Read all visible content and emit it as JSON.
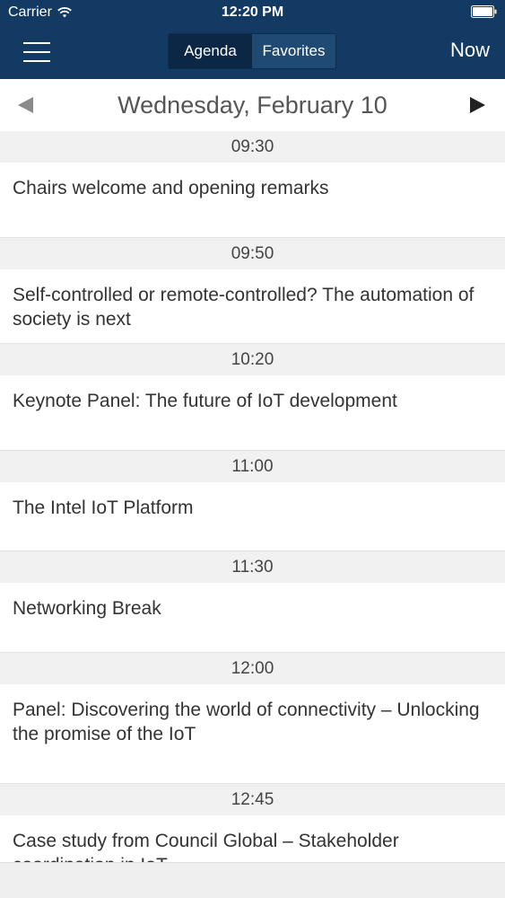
{
  "status_bar": {
    "carrier": "Carrier",
    "time": "12:20 PM"
  },
  "nav": {
    "segments": [
      "Agenda",
      "Favorites"
    ],
    "active_segment": "Agenda",
    "now_label": "Now"
  },
  "date_bar": {
    "date": "Wednesday, February 10"
  },
  "schedule": [
    {
      "time": "09:30",
      "title": "Chairs welcome and opening remarks"
    },
    {
      "time": "09:50",
      "title": "Self-controlled or remote-controlled? The automation of society is next"
    },
    {
      "time": "10:20",
      "title": "Keynote Panel: The future of IoT development"
    },
    {
      "time": "11:00",
      "title": "The Intel IoT Platform"
    },
    {
      "time": "11:30",
      "title": "Networking Break"
    },
    {
      "time": "12:00",
      "title": "Panel: Discovering the world of connectivity – Unlocking the promise of the IoT"
    },
    {
      "time": "12:45",
      "title": "Case study from Council Global – Stakeholder coordination in IoT"
    }
  ],
  "colors": {
    "nav_background": "#123a63",
    "time_header_background": "#f1f1f1"
  }
}
